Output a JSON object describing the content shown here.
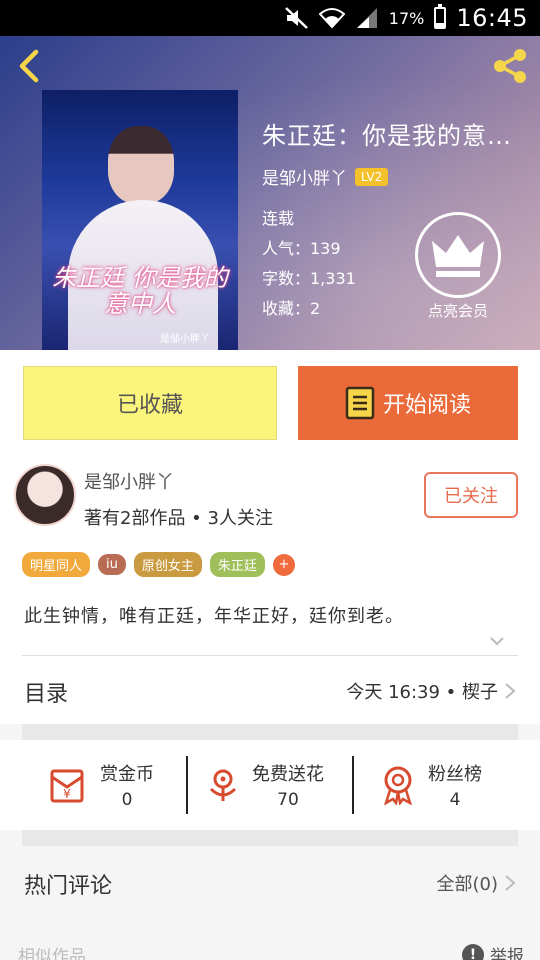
{
  "status_bar": {
    "battery": "17%",
    "time": "16:45"
  },
  "book": {
    "title": "朱正廷：你是我的意…",
    "cover_title": "朱正廷 你是我的意中人",
    "cover_author": "是邹小胖丫",
    "author": "是邹小胖丫",
    "author_level": "LV2",
    "status": "连载",
    "popularity": "人气：139",
    "word_count": "字数：1,331",
    "favorites": "收藏：2",
    "vip_label": "点亮会员"
  },
  "actions": {
    "collected_label": "已收藏",
    "read_label": "开始阅读"
  },
  "author_card": {
    "name": "是邹小胖丫",
    "stats": "著有2部作品 • 3人关注",
    "follow_label": "已关注"
  },
  "tags": [
    {
      "label": "明星同人",
      "color": "#f2a93b"
    },
    {
      "label": "iu",
      "color": "#b86c54"
    },
    {
      "label": "原创女主",
      "color": "#c99a3f"
    },
    {
      "label": "朱正廷",
      "color": "#9fbf5b"
    }
  ],
  "tag_add": "+",
  "description": "此生钟情，唯有正廷，年华正好，廷你到老。",
  "catalog": {
    "title": "目录",
    "latest": "今天 16:39 • 楔子"
  },
  "stats": {
    "reward": {
      "label": "赏金币",
      "value": "0"
    },
    "flowers": {
      "label": "免费送花",
      "value": "70"
    },
    "fans": {
      "label": "粉丝榜",
      "value": "4"
    }
  },
  "hot_comments": {
    "title": "热门评论",
    "all": "全部(0)"
  },
  "bottom": {
    "similar": "相似作品",
    "report": "举报"
  },
  "colors": {
    "accent": "#ea6a3a",
    "collect_bg": "#fbf57c",
    "vip_badge": "#f5c12a"
  }
}
